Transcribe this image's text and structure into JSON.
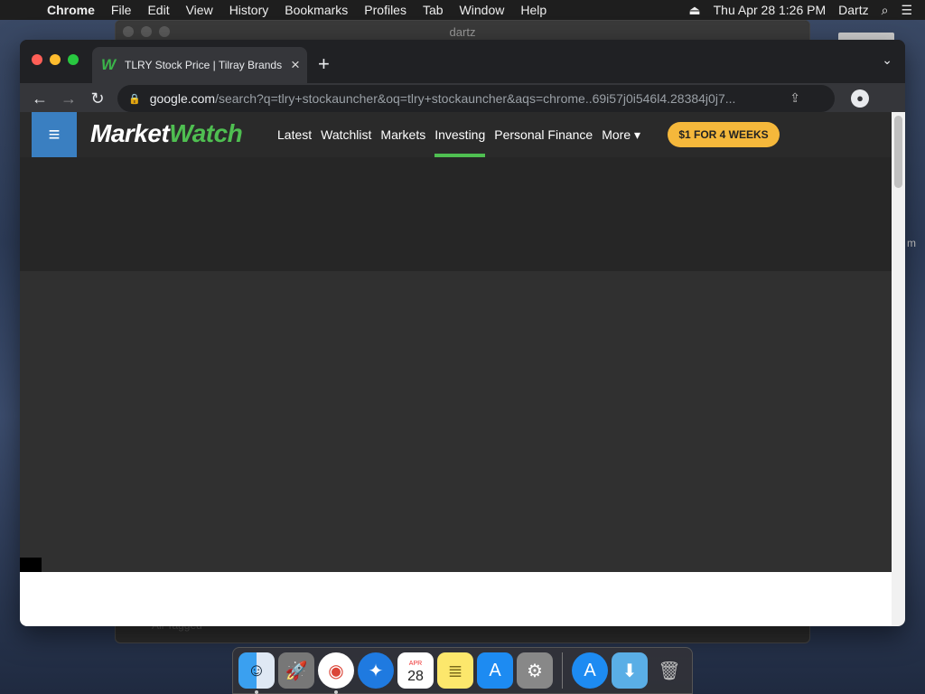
{
  "menubar": {
    "app": "Chrome",
    "items": [
      "File",
      "Edit",
      "View",
      "History",
      "Bookmarks",
      "Profiles",
      "Tab",
      "Window",
      "Help"
    ],
    "datetime": "Thu Apr 28  1:26 PM",
    "user": "Dartz"
  },
  "bg_window": {
    "title": "dartz",
    "fade_text": "All Tagged"
  },
  "side_text": "m",
  "tab": {
    "title": "TLRY Stock Price | Tilray Brands",
    "favicon": "W"
  },
  "omnibox": {
    "host": "google.com",
    "path": "/search?q=tlry+stockauncher&oq=tlry+stockauncher&aqs=chrome..69i57j0i546l4.28384j0j7..."
  },
  "site": {
    "logo_part1": "Market",
    "logo_part2": "Watch",
    "nav": [
      "Latest",
      "Watchlist",
      "Markets",
      "Investing",
      "Personal Finance",
      "More ▾"
    ],
    "active_nav": "Investing",
    "subscribe_label": "$1 FOR 4 WEEKS",
    "accent_color": "#4fbf51",
    "button_color": "#f5b83b"
  },
  "dock": {
    "calendar_month": "APR",
    "calendar_day": "28"
  }
}
